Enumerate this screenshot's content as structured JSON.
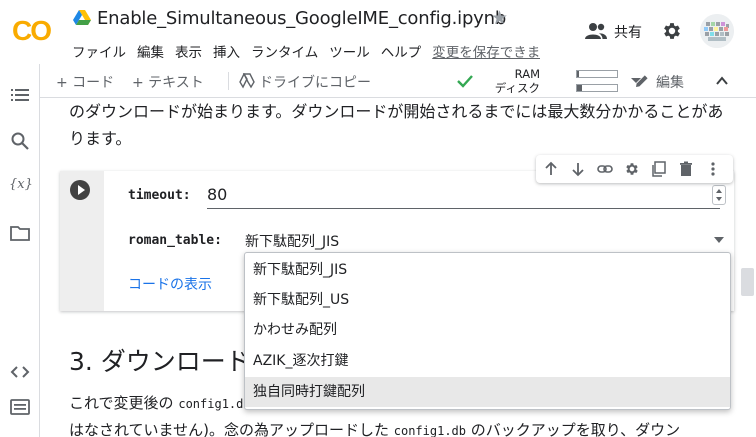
{
  "app": {
    "logo_text": "CO",
    "notebook_title": "Enable_Simultaneous_GoogleIME_config.ipynb",
    "menu": [
      "ファイル",
      "編集",
      "表示",
      "挿入",
      "ランタイム",
      "ツール",
      "ヘルプ"
    ],
    "save_link": "変更を保存できま",
    "share_label": "共有"
  },
  "toolbar": {
    "add_code": "+ コード",
    "add_text": "+ テキスト",
    "copy_to_drive": "ドライブにコピー",
    "ram_label": "RAM",
    "disk_label": "ディスク",
    "ram_usage": 0.05,
    "disk_usage": 0.12,
    "edit_label": "編集"
  },
  "content": {
    "paragraph_top": "のダウンロードが始まります。ダウンロードが開始されるまでには最大数分かかることがあります。",
    "timeout_label": "timeout:",
    "timeout_value": "80",
    "roman_table_label": "roman_table:",
    "roman_table_value": "新下駄配列_JIS",
    "show_code": "コードの表示",
    "options": [
      "新下駄配列_JIS",
      "新下駄配列_US",
      "かわせみ配列",
      "AZIK_逐次打鍵",
      "独自同時打鍵配列"
    ],
    "selected_option_index": 4,
    "section_heading": "3. ダウンロード",
    "para_bottom_1a": "これで変更後の",
    "para_bottom_1b": "config1.d",
    "para_bottom_2a": "はなされていません)。念の為アップロードした",
    "para_bottom_2b": "config1.db",
    "para_bottom_2c": "のバックアップを取り、ダウン"
  },
  "colors": {
    "logo_orange": "#F9AB00",
    "logo_deep": "#E8710A",
    "link_blue": "#1a73e8",
    "check_green": "#34a853",
    "selected_bg": "#e8e8e8"
  }
}
